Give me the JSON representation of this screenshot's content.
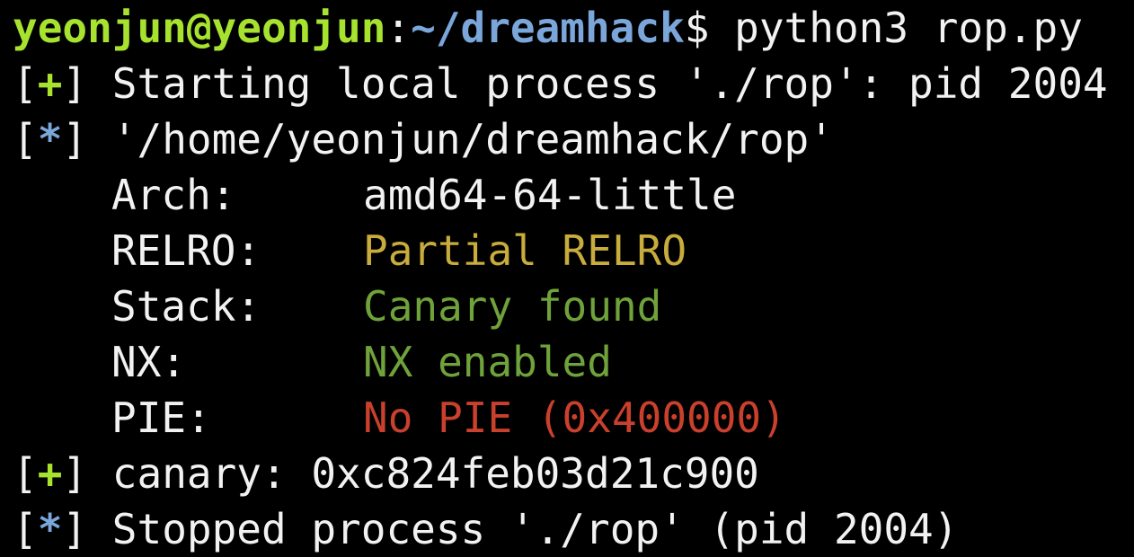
{
  "prompt": {
    "user_host": "yeonjun@yeonjun",
    "separator": ":",
    "path": "~/dreamhack",
    "dollar": "$",
    "command": " python3 rop.py"
  },
  "lines": [
    {
      "marker": "+",
      "text": " Starting local process './rop': pid 2004"
    },
    {
      "marker": "*",
      "text": " '/home/yeonjun/dreamhack/rop'"
    }
  ],
  "checksec": {
    "arch": {
      "key": "Arch:",
      "value": "amd64-64-little"
    },
    "relro": {
      "key": "RELRO:",
      "value": "Partial RELRO"
    },
    "stack": {
      "key": "Stack:",
      "value": "Canary found"
    },
    "nx": {
      "key": "NX:",
      "value": "NX enabled"
    },
    "pie": {
      "key": "PIE:",
      "value": "No PIE (0x400000)"
    }
  },
  "canary_line": {
    "marker": "+",
    "text": " canary: 0xc824feb03d21c900"
  },
  "stopped_line": {
    "marker": "*",
    "text": " Stopped process './rop' (pid 2004)"
  },
  "colors": {
    "background": "#000000",
    "foreground": "#f2f2f2",
    "user": "#a6e22e",
    "path": "#7aa6da",
    "yellow": "#c8ac3c",
    "green": "#6fa23a",
    "red": "#c9402c"
  }
}
